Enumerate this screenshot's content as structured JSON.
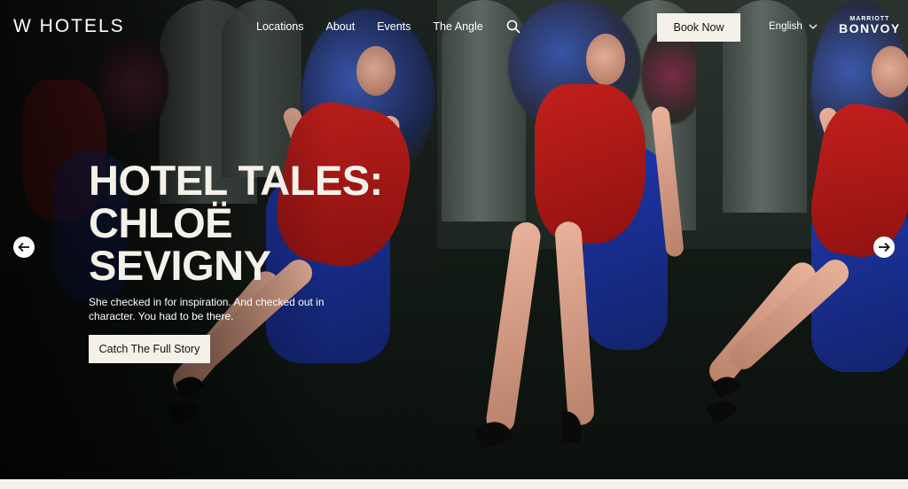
{
  "header": {
    "logo": "W HOTELS",
    "nav": [
      "Locations",
      "About",
      "Events",
      "The Angle"
    ],
    "search_icon": "search-icon",
    "book_label": "Book Now",
    "language": "English",
    "brand_top": "MARRIOTT",
    "brand_main": "BONVOY"
  },
  "hero": {
    "title_lines": [
      "HOTEL TALES:",
      "CHLOË",
      "SEVIGNY"
    ],
    "subtitle": "She checked in for inspiration. And checked out in character. You had to be there.",
    "cta_label": "Catch The Full Story",
    "prev_icon": "arrow-left-icon",
    "next_icon": "arrow-right-icon"
  },
  "colors": {
    "cream": "#f4f1e8",
    "dress_red": "#c21f1c",
    "chair_blue": "#1e36a8",
    "dark_bg": "#0d120f"
  }
}
